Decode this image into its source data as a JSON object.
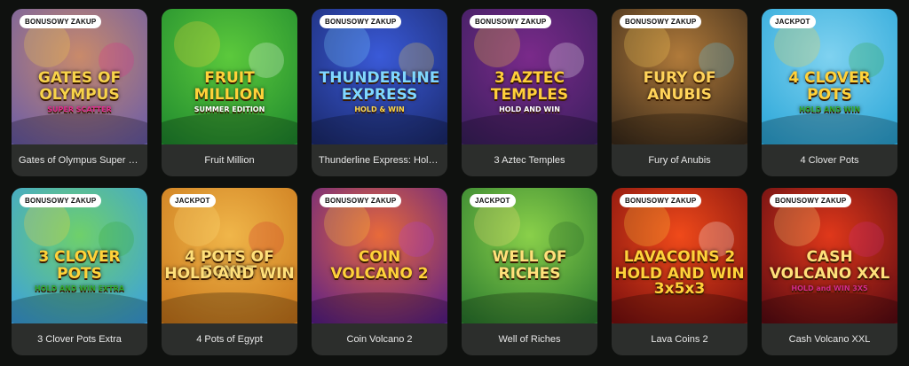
{
  "games": [
    {
      "title": "Gates of Olympus Super Sc...",
      "badge": "BONUSOWY ZAKUP",
      "logo_lines": [
        "GATES OF",
        "OLYMPUS",
        "SUPER SCATTER"
      ],
      "colors": {
        "bg1": "#6a5ca8",
        "bg2": "#c98a6a",
        "logo": "#f7d34a",
        "logo2": "#e02b8c"
      }
    },
    {
      "title": "Fruit Million",
      "badge": "",
      "logo_lines": [
        "FRUIT",
        "MILLION",
        "SUMMER EDITION"
      ],
      "colors": {
        "bg1": "#1f8a2e",
        "bg2": "#5cc93c",
        "logo": "#ffd23a",
        "logo2": "#ffffff"
      }
    },
    {
      "title": "Thunderline Express: Hold ...",
      "badge": "BONUSOWY ZAKUP",
      "logo_lines": [
        "THUNDERLINE",
        "EXPRESS",
        "HOLD & WIN"
      ],
      "colors": {
        "bg1": "#1b2a6e",
        "bg2": "#3a5ad8",
        "logo": "#7fd7ff",
        "logo2": "#ffd84a"
      }
    },
    {
      "title": "3 Aztec Temples",
      "badge": "BONUSOWY ZAKUP",
      "logo_lines": [
        "3 AZTEC",
        "TEMPLES",
        "HOLD AND WIN"
      ],
      "colors": {
        "bg1": "#3a1f5e",
        "bg2": "#7a2a8a",
        "logo": "#ffcf3a",
        "logo2": "#ffffff"
      }
    },
    {
      "title": "Fury of Anubis",
      "badge": "BONUSOWY ZAKUP",
      "logo_lines": [
        "FURY OF",
        "ANUBIS",
        ""
      ],
      "colors": {
        "bg1": "#3a2a1a",
        "bg2": "#b07a3a",
        "logo": "#ffd45a",
        "logo2": "#5bd1ff"
      }
    },
    {
      "title": "4 Clover Pots",
      "badge": "JACKPOT",
      "logo_lines": [
        "4 CLOVER",
        "POTS",
        "HOLD AND WIN"
      ],
      "colors": {
        "bg1": "#2aa6d8",
        "bg2": "#7fd2f0",
        "logo": "#ffd23a",
        "logo2": "#2fa82e"
      }
    },
    {
      "title": "3 Clover Pots Extra",
      "badge": "BONUSOWY ZAKUP",
      "logo_lines": [
        "3 CLOVER",
        "POTS",
        "HOLD AND WIN EXTRA"
      ],
      "colors": {
        "bg1": "#3aa0e0",
        "bg2": "#6fd06a",
        "logo": "#ffd23a",
        "logo2": "#2fa82e"
      }
    },
    {
      "title": "4 Pots of Egypt",
      "badge": "JACKPOT",
      "logo_lines": [
        "4 POTS OF EGYPT",
        "HOLD AND WIN",
        ""
      ],
      "colors": {
        "bg1": "#c9761a",
        "bg2": "#f0b64a",
        "logo": "#ffe07a",
        "logo2": "#d22a2a"
      }
    },
    {
      "title": "Coin Volcano 2",
      "badge": "BONUSOWY ZAKUP",
      "logo_lines": [
        "COIN",
        "VOLCANO 2",
        ""
      ],
      "colors": {
        "bg1": "#5a1e8a",
        "bg2": "#e86a3a",
        "logo": "#ffd23a",
        "logo2": "#b03ae0"
      }
    },
    {
      "title": "Well of Riches",
      "badge": "JACKPOT",
      "logo_lines": [
        "WELL OF",
        "RICHES",
        ""
      ],
      "colors": {
        "bg1": "#2a7a2e",
        "bg2": "#8ad04a",
        "logo": "#ffe07a",
        "logo2": "#1f5a22"
      }
    },
    {
      "title": "Lava Coins 2",
      "badge": "BONUSOWY ZAKUP",
      "logo_lines": [
        "LAVACOINS 2",
        "HOLD AND WIN 3x5x3",
        ""
      ],
      "colors": {
        "bg1": "#7a0e0e",
        "bg2": "#f04a1a",
        "logo": "#ffd23a",
        "logo2": "#ffffff"
      }
    },
    {
      "title": "Cash Volcano XXL",
      "badge": "BONUSOWY ZAKUP",
      "logo_lines": [
        "CASH",
        "VOLCANO XXL",
        "HOLD and WIN 3X5"
      ],
      "colors": {
        "bg1": "#5a0a12",
        "bg2": "#e0381a",
        "logo": "#ffe07a",
        "logo2": "#d22a8a"
      }
    }
  ]
}
